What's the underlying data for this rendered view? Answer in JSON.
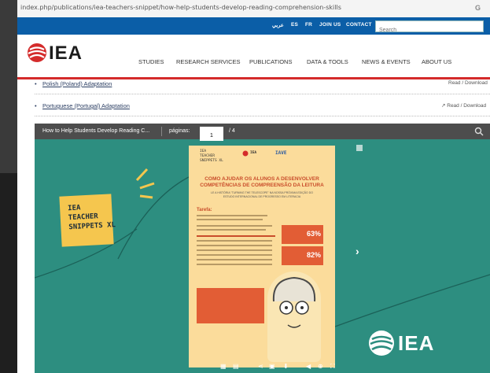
{
  "browser": {
    "url": "index.php/publications/iea-teachers-snippet/how-help-students-develop-reading-comprehension-skills",
    "google_icon": "G"
  },
  "topbar": {
    "lang_ar": "عربي",
    "lang_es": "ES",
    "lang_fr": "FR",
    "join": "JOIN US",
    "contact": "CONTACT",
    "search_placeholder": "Search"
  },
  "header": {
    "logo_text": "IEA",
    "nav": [
      "STUDIES",
      "RESEARCH SERVICES",
      "PUBLICATIONS",
      "DATA & TOOLS",
      "NEWS & EVENTS",
      "ABOUT US"
    ]
  },
  "list": {
    "item1": "Polish (Poland) Adaptation",
    "item1_right": "Read / Download",
    "item2": "Portuguese (Portugal) Adaptation",
    "item2_right": "↗ Read / Download"
  },
  "viewer": {
    "title": "How to Help Students Develop Reading C...",
    "pages_label": "páginas:",
    "current_page": "1",
    "total": "/ 4",
    "note_lines": [
      "IEA",
      "TEACHER",
      "SNIPPETS XL"
    ],
    "page": {
      "title": "COMO AJUDAR OS ALUNOS A DESENVOLVER COMPETÊNCIAS DE COMPREENSÃO DA LEITURA",
      "subtitle": "LE A HISTÓRIA \"TURNING THE TELESCOPE\" NA NOSSA PRÓXIMA EDIÇÃO DO",
      "subtitle2": "ESTUDO INTERNACIONAL DE PROGRESSO EM LITERACIA",
      "tarefa": "Tarefa:",
      "stat1": "63%",
      "stat2": "82%",
      "header_iea": "IEA",
      "header_iave": "IAVE",
      "header_left": [
        "IEA",
        "TEACHER",
        "SNIPPETS XL"
      ]
    },
    "brand": "IEA"
  }
}
